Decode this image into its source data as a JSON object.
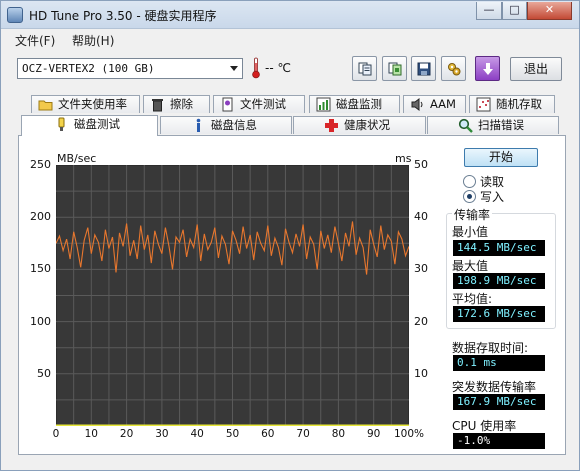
{
  "window": {
    "title": "HD Tune Pro 3.50 - 硬盘实用程序",
    "minimize": "—",
    "maximize": "□",
    "close": "✕"
  },
  "menu": [
    {
      "label": "文件(F)"
    },
    {
      "label": "帮助(H)"
    }
  ],
  "toolbar": {
    "drive": "OCZ-VERTEX2 (100 GB)",
    "temperature": "-- ℃",
    "exit_label": "退出",
    "buttons": [
      {
        "name": "copy-text-icon"
      },
      {
        "name": "copy-screenshot-icon"
      },
      {
        "name": "save-icon"
      },
      {
        "name": "options-icon"
      },
      {
        "name": "download-icon"
      }
    ]
  },
  "tabs_row1": [
    {
      "label": "文件夹使用率",
      "icon": "folder-icon"
    },
    {
      "label": "擦除",
      "icon": "trash-icon"
    },
    {
      "label": "文件测试",
      "icon": "file-test-icon"
    },
    {
      "label": "磁盘监测",
      "icon": "disk-monitor-icon"
    },
    {
      "label": "AAM",
      "icon": "speaker-icon"
    },
    {
      "label": "随机存取",
      "icon": "random-access-icon"
    }
  ],
  "tabs_row2": [
    {
      "label": "磁盘测试",
      "icon": "benchmark-icon",
      "active": true
    },
    {
      "label": "磁盘信息",
      "icon": "info-icon"
    },
    {
      "label": "健康状况",
      "icon": "health-icon"
    },
    {
      "label": "扫描错误",
      "icon": "scan-icon"
    }
  ],
  "chart_data": {
    "type": "line",
    "left_unit": "MB/sec",
    "right_unit": "ms",
    "ylim": [
      0,
      250
    ],
    "ylim_right": [
      0,
      50
    ],
    "yticks": [
      250,
      200,
      150,
      100,
      50
    ],
    "yticks_right": [
      50,
      40,
      30,
      20,
      10
    ],
    "xlim": [
      0,
      100
    ],
    "xticks": [
      "0",
      "10",
      "20",
      "30",
      "40",
      "50",
      "60",
      "70",
      "80",
      "90",
      "100%"
    ],
    "grid": true,
    "series": [
      {
        "name": "传输率",
        "color": "#e8772e",
        "axis": "left",
        "x": [
          0,
          1,
          2,
          3,
          4,
          5,
          6,
          7,
          8,
          9,
          10,
          11,
          12,
          13,
          14,
          15,
          16,
          17,
          18,
          19,
          20,
          21,
          22,
          23,
          24,
          25,
          26,
          27,
          28,
          29,
          30,
          31,
          32,
          33,
          34,
          35,
          36,
          37,
          38,
          39,
          40,
          41,
          42,
          43,
          44,
          45,
          46,
          47,
          48,
          49,
          50,
          51,
          52,
          53,
          54,
          55,
          56,
          57,
          58,
          59,
          60,
          61,
          62,
          63,
          64,
          65,
          66,
          67,
          68,
          69,
          70,
          71,
          72,
          73,
          74,
          75,
          76,
          77,
          78,
          79,
          80,
          81,
          82,
          83,
          84,
          85,
          86,
          87,
          88,
          89,
          90,
          91,
          92,
          93,
          94,
          95,
          96,
          97,
          98,
          99,
          100
        ],
        "values": [
          175,
          182,
          168,
          179,
          160,
          186,
          171,
          152,
          178,
          190,
          165,
          183,
          176,
          158,
          188,
          170,
          181,
          147,
          185,
          172,
          194,
          163,
          178,
          160,
          192,
          169,
          183,
          156,
          187,
          174,
          165,
          190,
          172,
          150,
          181,
          176,
          188,
          162,
          179,
          171,
          193,
          158,
          184,
          169,
          176,
          190,
          161,
          182,
          174,
          155,
          187,
          178,
          165,
          191,
          170,
          183,
          159,
          186,
          175,
          168,
          192,
          163,
          180,
          171,
          154,
          189,
          176,
          166,
          184,
          172,
          193,
          160,
          181,
          174,
          150,
          187,
          170,
          183,
          166,
          191,
          175,
          158,
          185,
          172,
          196,
          164,
          180,
          171,
          145,
          188,
          174,
          162,
          192,
          169,
          183,
          177,
          155,
          186,
          179,
          163,
          172
        ]
      },
      {
        "name": "存取时间",
        "color": "#e8e83a",
        "axis": "right",
        "x": [
          0,
          10,
          20,
          30,
          40,
          50,
          60,
          70,
          80,
          90,
          100
        ],
        "values": [
          0.1,
          0.1,
          0.1,
          0.1,
          0.1,
          0.1,
          0.1,
          0.1,
          0.1,
          0.1,
          0.1
        ]
      }
    ]
  },
  "side": {
    "start_label": "开始",
    "read_label": "读取",
    "write_label": "写入",
    "mode_selected": "写入",
    "transfer_title": "传输率",
    "min_label": "最小值",
    "min_value": "144.5 MB/sec",
    "max_label": "最大值",
    "max_value": "198.9 MB/sec",
    "avg_label": "平均值:",
    "avg_value": "172.6 MB/sec",
    "access_label": "数据存取时间:",
    "access_value": "0.1 ms",
    "burst_label": "突发数据传输率",
    "burst_value": "167.9 MB/sec",
    "cpu_label": "CPU 使用率",
    "cpu_value": "-1.0%"
  }
}
